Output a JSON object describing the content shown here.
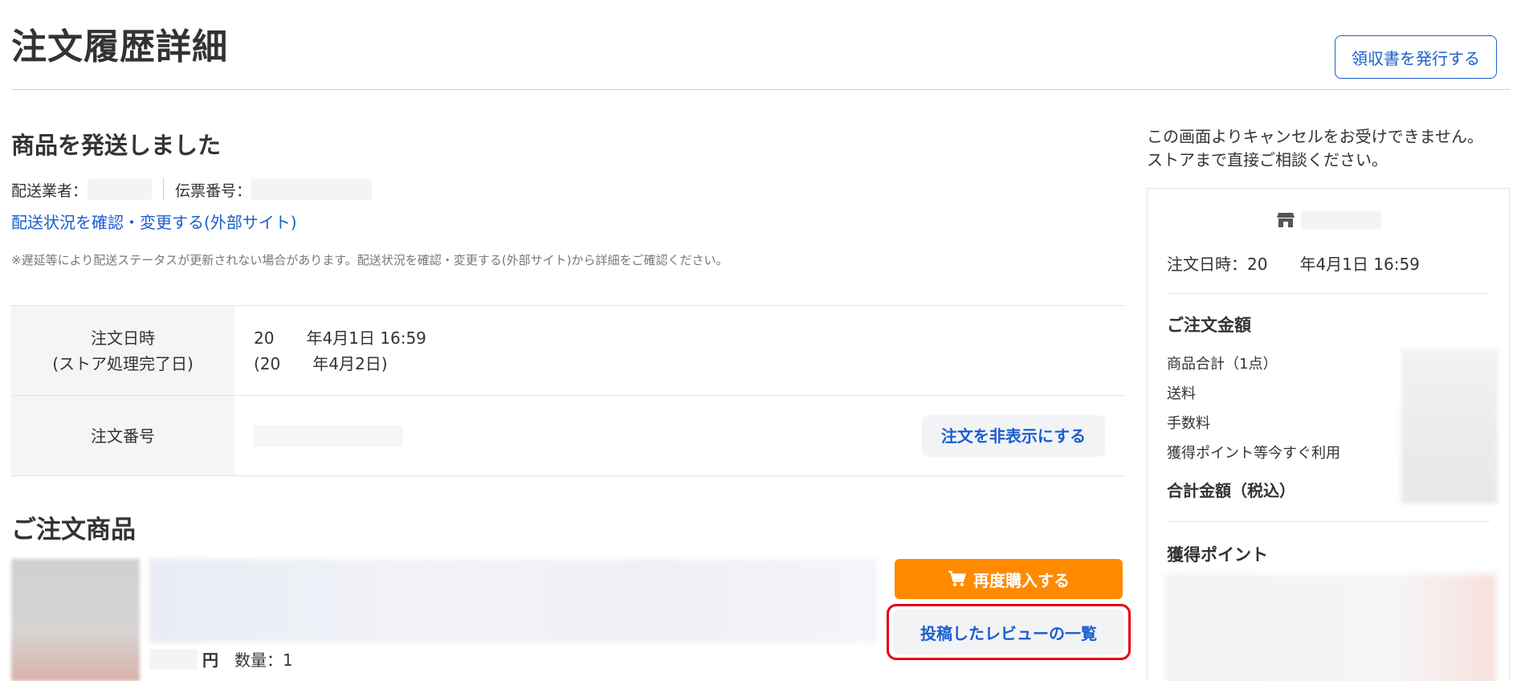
{
  "header": {
    "title": "注文履歴詳細",
    "receipt_button": "領収書を発行する"
  },
  "shipping": {
    "heading": "商品を発送しました",
    "carrier_label": "配送業者：",
    "tracking_label": "伝票番号：",
    "tracking_link": "配送状況を確認・変更する(外部サイト)",
    "note": "※遅延等により配送ステータスが更新されない場合があります。配送状況を確認・変更する(外部サイト)から詳細をご確認ください。"
  },
  "order_info": {
    "date_label_1": "注文日時",
    "date_label_2": "(ストア処理完了日)",
    "date_value_1": "20　　年4月1日 16:59",
    "date_value_2": "(20　　年4月2日)",
    "number_label": "注文番号",
    "hide_button": "注文を非表示にする"
  },
  "items": {
    "heading": "ご注文商品",
    "yen": "円",
    "quantity": "数量：1",
    "rebuy_button": "再度購入する",
    "review_button": "投稿したレビューの一覧"
  },
  "sidebar": {
    "cancel_note_1": "この画面よりキャンセルをお受けできません。",
    "cancel_note_2": "ストアまで直接ご相談ください。",
    "order_date": "注文日時：20　　年4月1日 16:59",
    "amount_heading": "ご注文金額",
    "fees": [
      "商品合計（1点）",
      "送料",
      "手数料",
      "獲得ポイント等今すぐ利用"
    ],
    "total_label": "合計金額（税込）",
    "points_heading": "獲得ポイント"
  },
  "colors": {
    "link": "#1a5fcf",
    "rebuy": "#ff8a00",
    "highlight": "#e60012"
  },
  "icons": [
    "store-icon",
    "cart-icon"
  ]
}
